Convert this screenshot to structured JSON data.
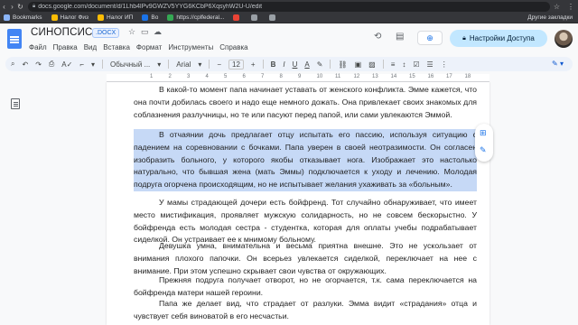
{
  "browser": {
    "url": "docs.google.com/document/d/1Lhb4lPv9GWZV5YYG6KCbP6XqsyhW2U-U/edit",
    "bookmarks": [
      {
        "label": "Bookmarks",
        "color": "#8ab4f8"
      },
      {
        "label": "Налог Физ",
        "color": "#fbbc04"
      },
      {
        "label": "Налог ИП",
        "color": "#fbbc04"
      },
      {
        "label": "Bo",
        "color": "#1a73e8"
      },
      {
        "label": "https://cplfederal...",
        "color": "#34a853"
      },
      {
        "label": "",
        "color": "#ea4335"
      },
      {
        "label": "",
        "color": "#9aa0a6"
      },
      {
        "label": "",
        "color": "#9aa0a6"
      }
    ],
    "other_bookmarks": "Другие закладки"
  },
  "doc": {
    "title": "СИНОПСИС",
    "format_badge": ".DOCX",
    "share_label": "Настройки Доступа"
  },
  "menu": [
    "Файл",
    "Правка",
    "Вид",
    "Вставка",
    "Формат",
    "Инструменты",
    "Справка"
  ],
  "toolbar": {
    "style": "Обычный ...",
    "font": "Arial",
    "font_size": "12"
  },
  "ruler_labels": [
    "1",
    "2",
    "3",
    "4",
    "5",
    "6",
    "7",
    "8",
    "9",
    "10",
    "11",
    "12",
    "13",
    "14",
    "15",
    "16",
    "17",
    "18"
  ],
  "paragraphs": [
    {
      "text": "В какой-то момент папа начинает уставать от женского конфликта. Эмме кажется, что она почти добилась своего и надо еще немного дожать. Она привлекает своих знакомых для соблазнения разлучницы, но те или пасуют перед папой, или сами увлекаются Эммой.",
      "highlighted": false
    },
    {
      "text": "В отчаянии дочь предлагает отцу испытать его пассию, используя ситуацию с падением на соревновании с бочками. Папа уверен в своей неотразимости. Он согласен изобразить больного, у которого якобы отказывает нога. Изображает это настолько натурально, что бывшая жена (мать Эммы) подключается к уходу и лечению. Молодая подруга огорчена происходящим, но не испытывает желания ухаживать за «больным».",
      "highlighted": true
    },
    {
      "text": "У мамы страдающей дочери есть бойфренд. Тот случайно обнаруживает, что имеет место мистификация, проявляет мужскую солидарность, но не совсем бескорыстно. У бойфренда есть молодая сестра - студентка, которая для оплаты учебы подрабатывает сиделкой. Он устраивает ее к мнимому больному.",
      "highlighted": false
    },
    {
      "text": "Девушка умна, внимательна и весьма приятна внешне. Это не ускользает от внимания плохого папочки. Он всерьез увлекается сиделкой, переключает на нее с внимание. При этом успешно скрывает свои чувства от окружающих.",
      "highlighted": false
    },
    {
      "text": "Прежняя подруга получает отворот, но не огорчается, т.к. сама переключается на бойфренда матери нашей героини.",
      "highlighted": false
    },
    {
      "text": "Папа же делает вид, что страдает от разлуки. Эмма видит «страдания» отца и чувствует себя виноватой в его несчастьи.",
      "highlighted": false
    }
  ]
}
